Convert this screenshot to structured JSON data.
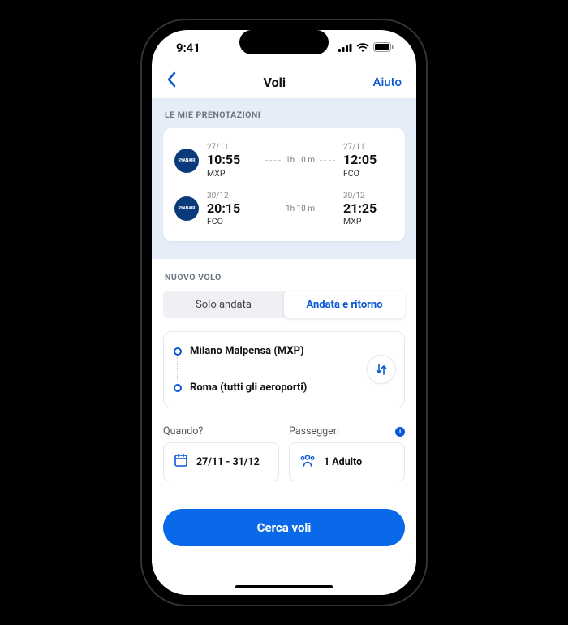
{
  "status": {
    "time": "9:41"
  },
  "nav": {
    "title": "Voli",
    "help": "Aiuto"
  },
  "bookings": {
    "label": "LE MIE PRENOTAZIONI",
    "items": [
      {
        "airline": "RYANAIR",
        "dep": {
          "date": "27/11",
          "time": "10:55",
          "code": "MXP"
        },
        "duration": "1h 10 m",
        "arr": {
          "date": "27/11",
          "time": "12:05",
          "code": "FCO"
        }
      },
      {
        "airline": "RYANAIR",
        "dep": {
          "date": "30/12",
          "time": "20:15",
          "code": "FCO"
        },
        "duration": "1h 10 m",
        "arr": {
          "date": "30/12",
          "time": "21:25",
          "code": "MXP"
        }
      }
    ]
  },
  "newflight": {
    "label": "NUOVO VOLO",
    "tabs": {
      "oneway": "Solo andata",
      "roundtrip": "Andata e ritorno"
    },
    "origin": "Milano Malpensa (MXP)",
    "destination": "Roma (tutti gli aeroporti)",
    "when": {
      "label": "Quando?",
      "value": "27/11 - 31/12"
    },
    "passengers": {
      "label": "Passeggeri",
      "value": "1 Adulto"
    },
    "cta": "Cerca voli"
  }
}
